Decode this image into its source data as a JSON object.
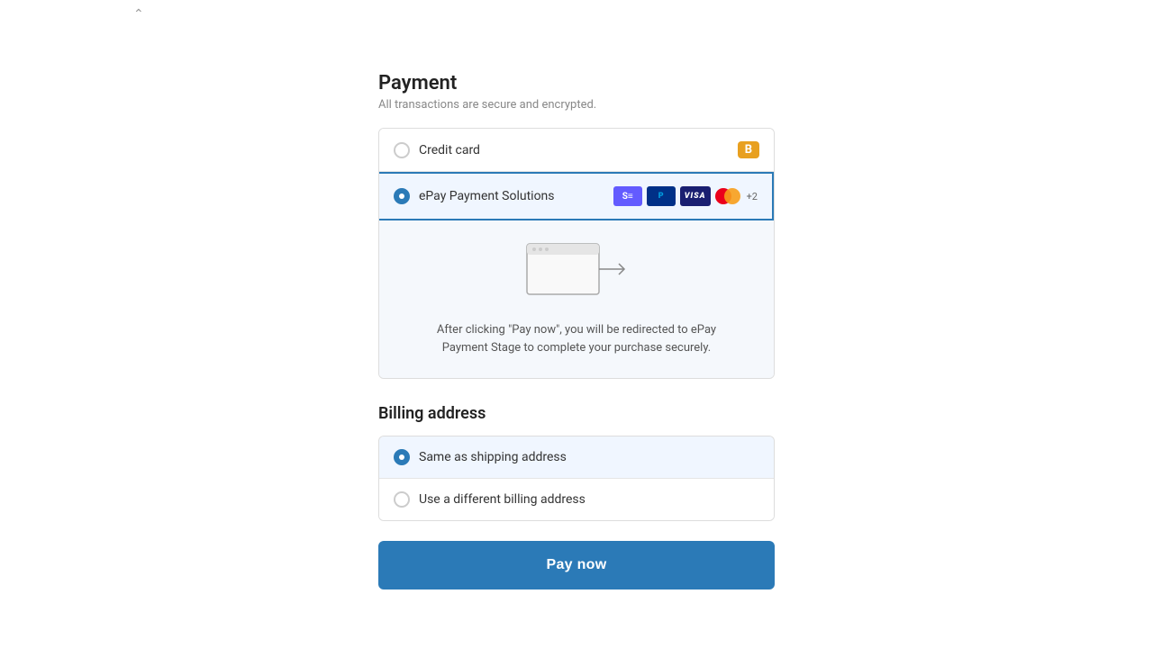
{
  "page": {
    "chevron": "⌃"
  },
  "payment": {
    "title": "Payment",
    "subtitle": "All transactions are secure and encrypted.",
    "options": [
      {
        "id": "credit-card",
        "label": "Credit card",
        "selected": false,
        "badge": "B",
        "showBadge": true,
        "showIcons": false
      },
      {
        "id": "epay",
        "label": "ePay Payment Solutions",
        "selected": true,
        "badge": "",
        "showBadge": false,
        "showIcons": true
      }
    ],
    "redirect": {
      "line1": "After clicking \"Pay now\", you will be redirected to ePay",
      "line2": "Payment Stage to complete your purchase securely."
    }
  },
  "billing": {
    "title": "Billing address",
    "options": [
      {
        "id": "same-shipping",
        "label": "Same as shipping address",
        "selected": true
      },
      {
        "id": "different-billing",
        "label": "Use a different billing address",
        "selected": false
      }
    ]
  },
  "cta": {
    "label": "Pay now"
  }
}
